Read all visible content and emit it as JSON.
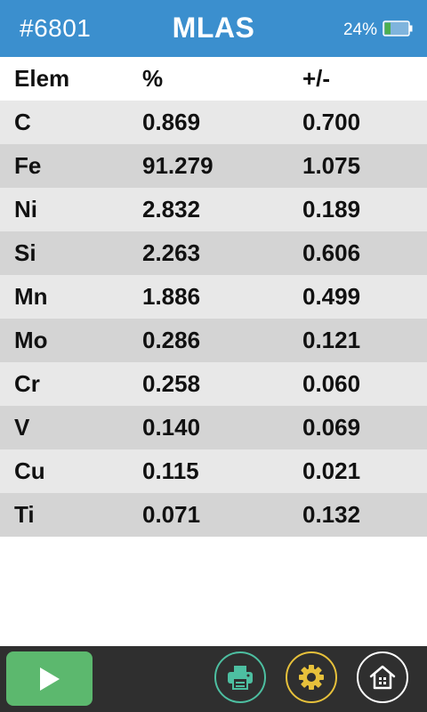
{
  "header": {
    "sample_id": "#6801",
    "mode": "MLAS",
    "battery": "24%"
  },
  "table": {
    "columns": [
      "Elem",
      "%",
      "+/-"
    ],
    "rows": [
      [
        "C",
        "0.869",
        "0.700"
      ],
      [
        "Fe",
        "91.279",
        "1.075"
      ],
      [
        "Ni",
        "2.832",
        "0.189"
      ],
      [
        "Si",
        "2.263",
        "0.606"
      ],
      [
        "Mn",
        "1.886",
        "0.499"
      ],
      [
        "Mo",
        "0.286",
        "0.121"
      ],
      [
        "Cr",
        "0.258",
        "0.060"
      ],
      [
        "V",
        "0.140",
        "0.069"
      ],
      [
        "Cu",
        "0.115",
        "0.021"
      ],
      [
        "Ti",
        "0.071",
        "0.132"
      ]
    ]
  },
  "toolbar": {
    "buttons": [
      {
        "name": "play",
        "icon": "play-icon",
        "color": "#5cb86e"
      },
      {
        "name": "print",
        "icon": "printer-icon",
        "color": "#4dbfa1"
      },
      {
        "name": "settings",
        "icon": "gear-icon",
        "color": "#e7c13b"
      },
      {
        "name": "home",
        "icon": "home-icon",
        "color": "#ffffff"
      }
    ]
  },
  "colors": {
    "header_bg": "#3b8fce",
    "row_light": "#e8e8e8",
    "row_dark": "#d4d4d4",
    "toolbar_bg": "#2f2f2f",
    "battery_fill": "#4caf50"
  }
}
